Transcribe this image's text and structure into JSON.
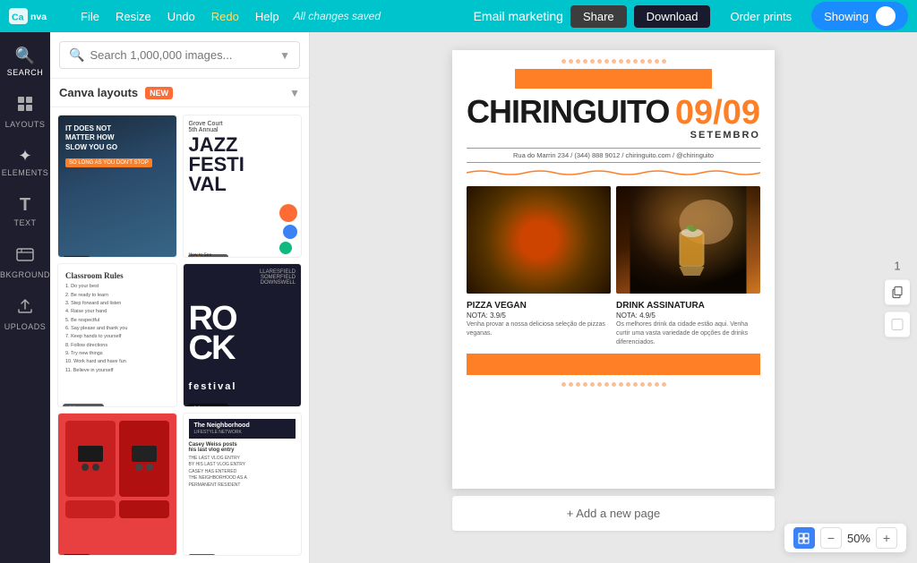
{
  "topnav": {
    "logo": "Canva",
    "menu": [
      "File",
      "Resize",
      "Undo",
      "Redo",
      "Help"
    ],
    "redo_label": "Redo",
    "status": "All changes saved",
    "project_title": "Email marketing",
    "btn_share": "Share",
    "btn_download": "Download",
    "btn_order": "Order prints",
    "btn_showing": "Showing"
  },
  "sidebar": {
    "items": [
      {
        "id": "search",
        "label": "Search",
        "icon": "🔍"
      },
      {
        "id": "layouts",
        "label": "Layouts",
        "icon": "⊞"
      },
      {
        "id": "elements",
        "label": "Elements",
        "icon": "✦"
      },
      {
        "id": "text",
        "label": "Text",
        "icon": "T"
      },
      {
        "id": "background",
        "label": "Bkground",
        "icon": "⬛"
      },
      {
        "id": "uploads",
        "label": "Uploads",
        "icon": "⬆"
      }
    ]
  },
  "panel": {
    "search_placeholder": "Search 1,000,000 images...",
    "filter_label": "Canva layouts",
    "filter_badge": "NEW",
    "templates": [
      {
        "id": "motivational",
        "badge": "FREE",
        "type": "free"
      },
      {
        "id": "jazz",
        "badge": "FREE",
        "type": "free"
      },
      {
        "id": "classroom",
        "badge": "FREE",
        "type": "free"
      },
      {
        "id": "rock",
        "badge": "FREE",
        "type": "free"
      },
      {
        "id": "cassette",
        "badge": "FREE",
        "type": "free"
      },
      {
        "id": "neighborhood",
        "badge": "FREE",
        "type": "free"
      }
    ]
  },
  "canvas": {
    "page_number": "1",
    "add_page_label": "+ Add a new page",
    "zoom_level": "50%"
  },
  "flyer": {
    "title": "CHIRINGUITO",
    "date": "09/09",
    "subtitle": "SETEMBRO",
    "address": "Rua do Marrin  234 / (344) 888 9012 / chiringuito.com / @chiringuito",
    "items": [
      {
        "name": "PIZZA VEGAN",
        "rating": "NOTA: 3.9/5",
        "desc": "Venha provar a nossa deliciosa seleção de pizzas veganas."
      },
      {
        "name": "DRINK ASSINATURA",
        "rating": "NOTA: 4.9/5",
        "desc": "Os melhores drink da cidade estão aqui. Venha curtir uma vasta variedade de opções de drinks diferenciados."
      }
    ]
  }
}
